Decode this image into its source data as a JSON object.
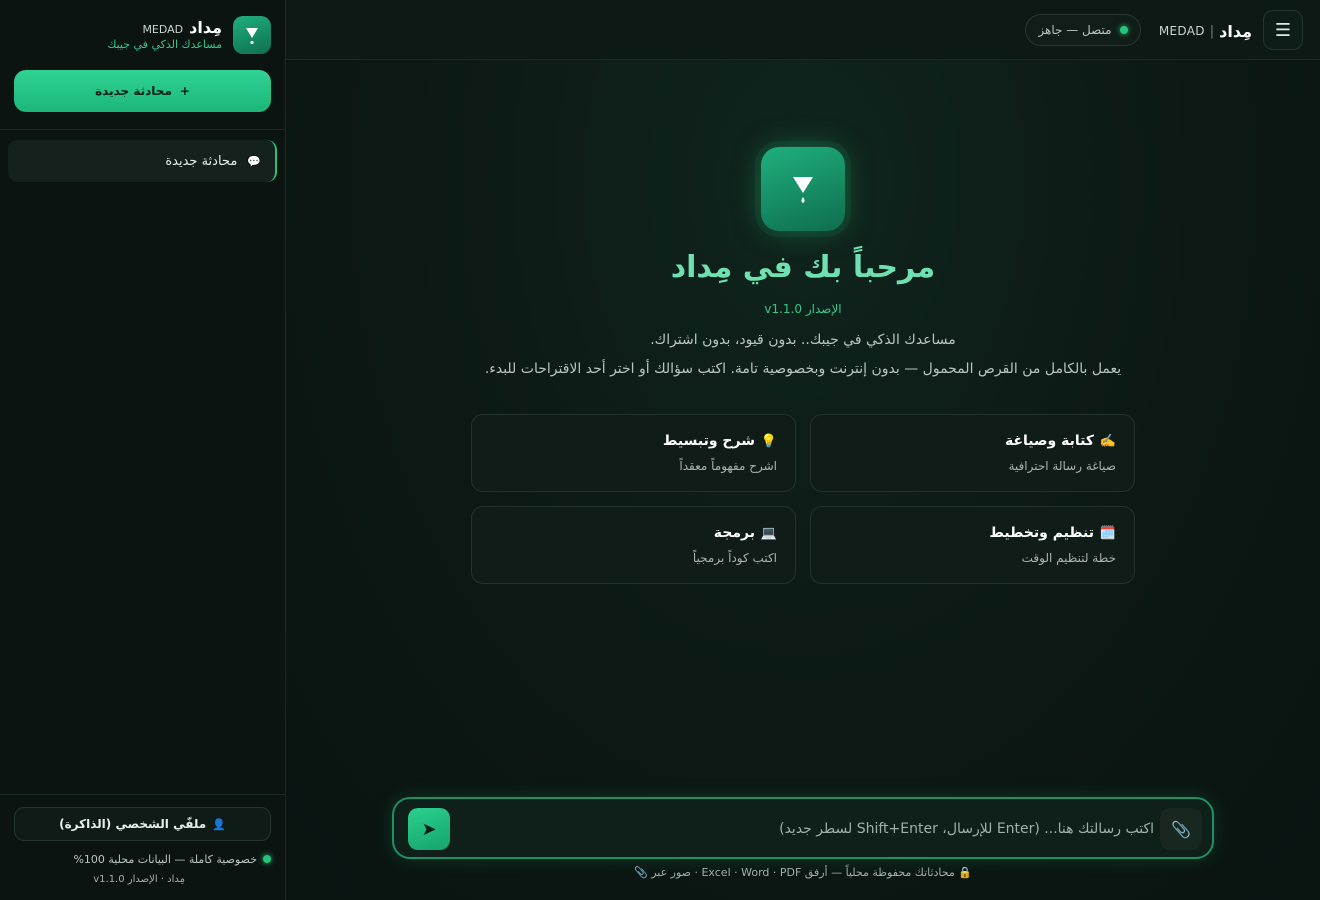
{
  "topbar": {
    "brand_ar": "مِداد",
    "brand_sep": "|",
    "brand_latin": "MEDAD",
    "status_text": "متصل — جاهز"
  },
  "hero": {
    "title": "مرحباً بك في مِداد",
    "version": "الإصدار v1.1.0",
    "line1": "مساعدك الذكي في جيبك.. بدون قيود، بدون اشتراك.",
    "line2": "يعمل بالكامل من القرص المحمول — بدون إنترنت وبخصوصية تامة. اكتب سؤالك أو اختر أحد الاقتراحات للبدء."
  },
  "suggestions": [
    {
      "icon": "✍️",
      "title": "كتابة وصياغة",
      "subtitle": "صياغة رسالة احترافية"
    },
    {
      "icon": "💡",
      "title": "شرح وتبسيط",
      "subtitle": "اشرح مفهوماً معقداً"
    },
    {
      "icon": "🗓️",
      "title": "تنظيم وتخطيط",
      "subtitle": "خطة لتنظيم الوقت"
    },
    {
      "icon": "💻",
      "title": "برمجة",
      "subtitle": "اكتب كوداً برمجياً"
    }
  ],
  "composer": {
    "placeholder": "اكتب رسالتك هنا... (Enter للإرسال، Shift+Enter لسطر جديد)",
    "value": ""
  },
  "footer_note": "🔒 محادثاتك محفوظة محلياً — أرفق Excel · Word · PDF · صور عبر 📎",
  "sidebar": {
    "brand_ar": "مِداد",
    "brand_latin": "MEDAD",
    "tagline": "مساعدك الذكي في جيبك",
    "new_chat_label": "محادثة جديدة",
    "new_chat_plus": "+",
    "history": [
      {
        "icon": "💬",
        "label": "محادثة جديدة"
      }
    ],
    "profile_icon": "👤",
    "profile_label": "ملفّي الشخصي (الذاكرة)",
    "privacy_text": "خصوصية كاملة — البيانات محلية 100%",
    "version_text": "مِداد · الإصدار v1.1.0"
  },
  "colors": {
    "accent": "#22c67b",
    "title": "#6fe0b0",
    "background": "#0b1512"
  }
}
